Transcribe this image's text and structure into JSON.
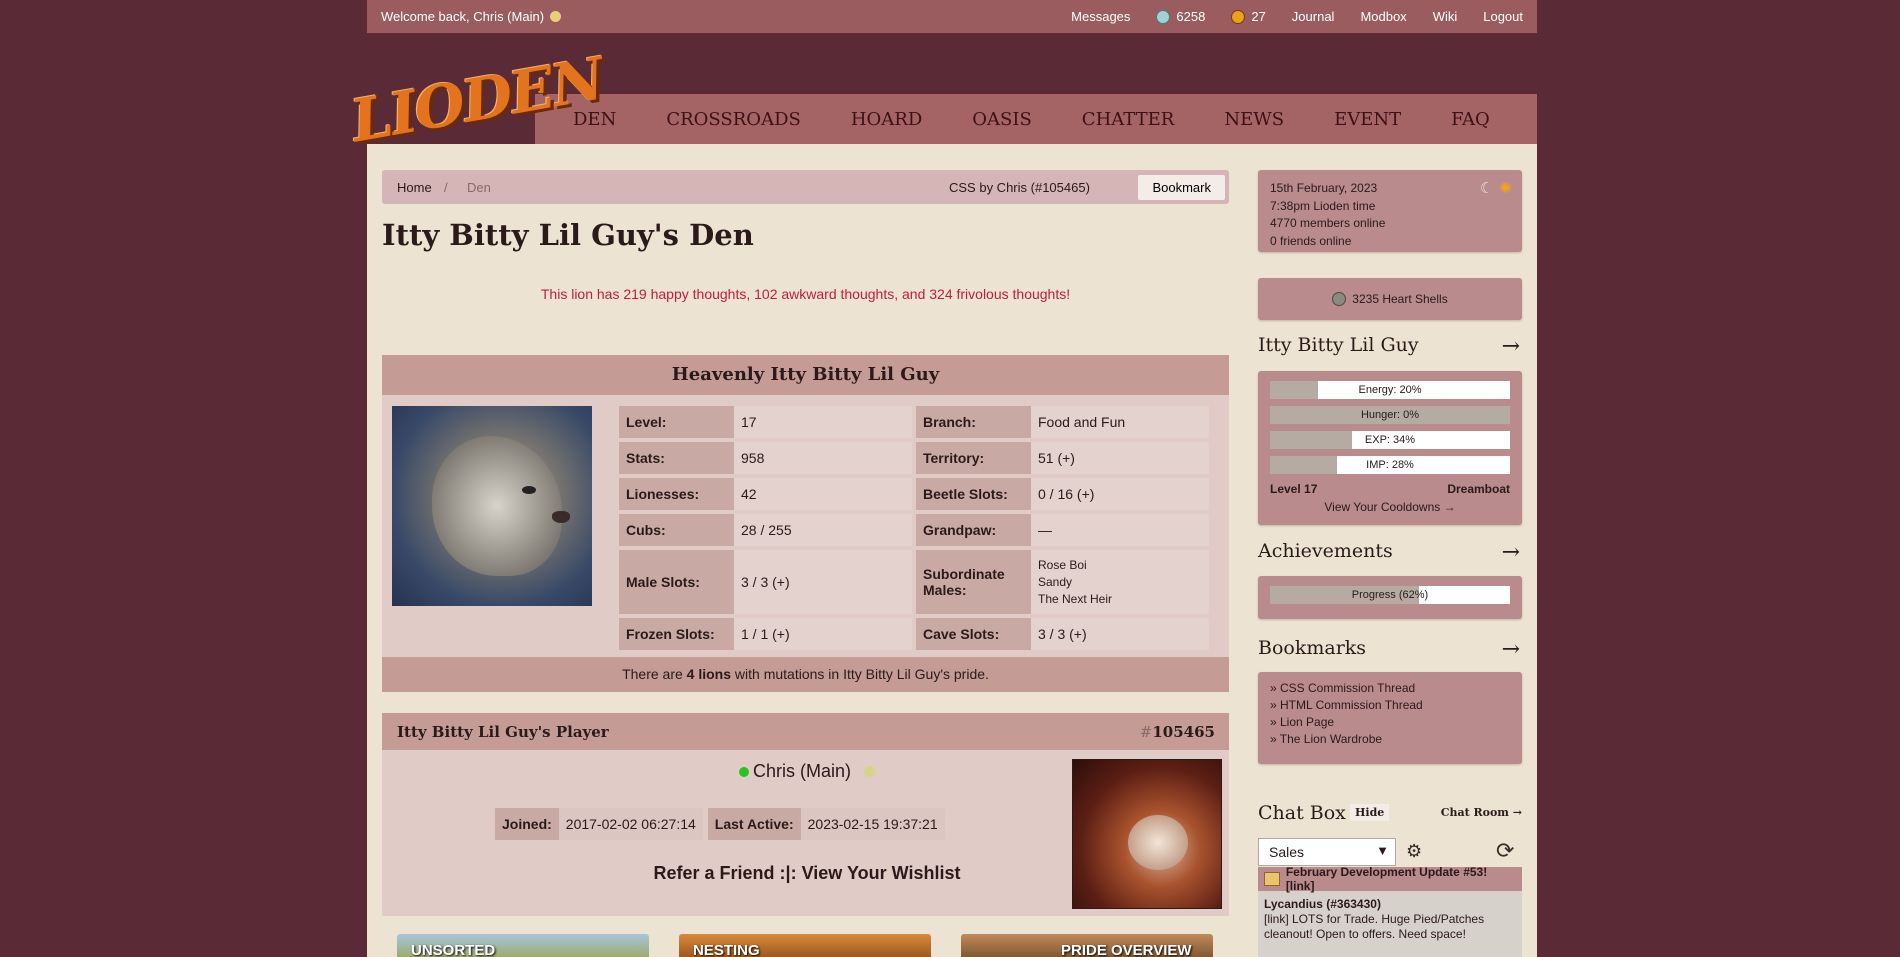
{
  "topbar": {
    "welcome": "Welcome back, Chris (Main)",
    "messages": "Messages",
    "gems_count": "6258",
    "beetle_count": "27",
    "journal": "Journal",
    "modbox": "Modbox",
    "wiki": "Wiki",
    "logout": "Logout"
  },
  "logo": {
    "text": "LIODEN"
  },
  "nav": [
    "DEN",
    "CROSSROADS",
    "HOARD",
    "OASIS",
    "CHATTER",
    "NEWS",
    "EVENT",
    "FAQ"
  ],
  "breadcrumb": {
    "home": "Home",
    "separator": "/",
    "current": "Den",
    "css_credit": "CSS by Chris (#105465)",
    "bookmark_label": "Bookmark"
  },
  "page": {
    "title": "Itty Bitty Lil Guy's Den",
    "thoughts": "This lion has 219 happy thoughts, 102 awkward thoughts, and 324 frivolous thoughts!"
  },
  "lion": {
    "header": "Heavenly Itty Bitty Lil Guy",
    "stats": {
      "level_k": "Level:",
      "level_v": "17",
      "branch_k": "Branch:",
      "branch_v": "Food and Fun",
      "stats_k": "Stats:",
      "stats_v": "958",
      "territory_k": "Territory:",
      "territory_v": "51 (+)",
      "lionesses_k": "Lionesses:",
      "lionesses_v": "42",
      "beetle_k": "Beetle Slots:",
      "beetle_v": "0 / 16 (+)",
      "cubs_k": "Cubs:",
      "cubs_v": "28 / 255",
      "grandpaw_k": "Grandpaw:",
      "grandpaw_v": "—",
      "male_k": "Male Slots:",
      "male_v": "3 / 3 (+)",
      "sub_k": "Subordinate Males:",
      "sub_v": [
        "Rose Boi",
        "Sandy",
        "The Next Heir"
      ],
      "frozen_k": "Frozen Slots:",
      "frozen_v": "1 / 1 (+)",
      "cave_k": "Cave Slots:",
      "cave_v": "3 / 3 (+)"
    },
    "mutation_pre": "There are ",
    "mutation_bold": "4 lions",
    "mutation_post": " with mutations in Itty Bitty Lil Guy's pride."
  },
  "player": {
    "header": "Itty Bitty Lil Guy's Player",
    "id_hash": "#",
    "id_num": "105465",
    "name": "Chris (Main)",
    "joined_k": "Joined:",
    "joined_v": "2017-02-02 06:27:14",
    "active_k": "Last Active:",
    "active_v": "2023-02-15 19:37:21",
    "refer": "Refer a Friend :|: View Your Wishlist"
  },
  "tiles": [
    "UNSORTED",
    "NESTING",
    "PRIDE OVERVIEW"
  ],
  "sidebar": {
    "date": "15th February, 2023",
    "time": "7:38pm Lioden time",
    "members": "4770 members online",
    "friends": "0 friends online",
    "heart_shells": "3235 Heart Shells",
    "lion_name": "Itty Bitty Lil Guy",
    "arrow": "→",
    "bars": [
      {
        "label": "Energy: 20%",
        "value": 20
      },
      {
        "label": "Hunger: 0%",
        "value": 0
      },
      {
        "label": "EXP: 34%",
        "value": 34
      },
      {
        "label": "IMP: 28%",
        "value": 28
      }
    ],
    "level": "Level 17",
    "title": "Dreamboat",
    "cooldowns": "View Your Cooldowns →",
    "achievements": "Achievements",
    "progress": {
      "label": "Progress (62%)",
      "value": 62
    },
    "bookmarks_title": "Bookmarks",
    "bookmarks": [
      "» CSS Commission Thread",
      "» HTML Commission Thread",
      "» Lion Page",
      "» The Lion Wardrobe"
    ],
    "chat_title": "Chat Box",
    "chat_hide": "Hide",
    "chat_room": "Chat Room →",
    "chat_select": "Sales",
    "chat_announce": "February Development Update #53! [link]",
    "chat_user": "Lycandius (#363430)",
    "chat_msg": "[link] LOTS for Trade. Huge Pied/Patches cleanout! Open to offers. Need space!"
  },
  "colors": {
    "bg": "#5a2a36",
    "topbar": "#9a5c5e",
    "panel": "#ede3d2",
    "accent_red": "#c01e3c"
  }
}
